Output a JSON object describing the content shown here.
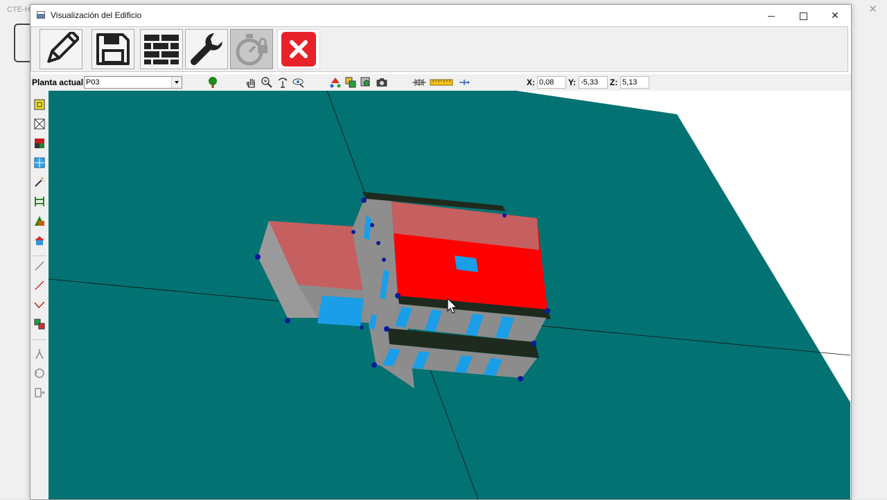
{
  "background_app": {
    "title": "CTE-H"
  },
  "window": {
    "title": "Visualización del Edificio"
  },
  "toolbar": {
    "buttons": [
      {
        "name": "edit",
        "icon": "pencil-icon"
      },
      {
        "name": "save",
        "icon": "floppy-disk-icon"
      },
      {
        "name": "materials",
        "icon": "brick-wall-icon"
      },
      {
        "name": "tools",
        "icon": "wrench-icon"
      },
      {
        "name": "calculate",
        "icon": "stopwatch-icon",
        "disabled": true
      },
      {
        "name": "close",
        "icon": "red-x-icon"
      }
    ]
  },
  "subtoolbar": {
    "planta_label": "Planta actual",
    "planta_value": "P03",
    "coords": {
      "x_label": "X:",
      "x_value": "0,08",
      "y_label": "Y:",
      "y_value": "-5,33",
      "z_label": "Z:",
      "z_value": "5,13"
    }
  },
  "colors": {
    "ground": "#037272",
    "roof_selected": "#ff0000",
    "roof": "#c65f5f",
    "wall": "#8c8c8c",
    "window": "#1a9ee8",
    "vertex": "#0a1a9a"
  }
}
